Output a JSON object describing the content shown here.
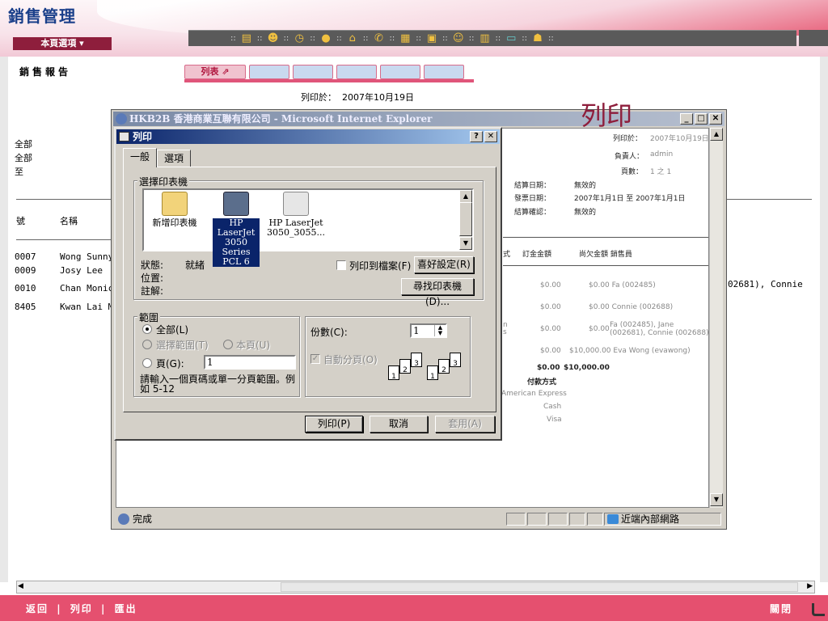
{
  "app": {
    "brand": "銷售管理",
    "menu_label": "本頁選項 ▾"
  },
  "toolbar": {
    "icons": [
      "docs-icon",
      "group-icon",
      "clock-icon",
      "coin-icon",
      "house-icon",
      "phone-icon",
      "calculator-icon",
      "clipboard-icon",
      "people-icon",
      "notepad-icon",
      "screen-icon",
      "users-icon"
    ]
  },
  "page": {
    "title": "銷售報告",
    "tabs": [
      "列表 ⇗",
      "",
      "",
      "",
      "",
      ""
    ],
    "printed_on_label": "列印於：",
    "printed_on_value": "2007年10月19日",
    "left_labels": [
      "全部",
      "全部",
      "至"
    ],
    "columns": {
      "no": "號",
      "name": "名稱"
    },
    "rows": [
      {
        "no": "0007",
        "name": "Wong Sunny"
      },
      {
        "no": "0009",
        "name": "Josy Lee"
      },
      {
        "no": "0010",
        "name": "Chan Monica"
      },
      {
        "no": "8405",
        "name": "Kwan Lai Ma"
      }
    ],
    "right_overflow": "02681), Connie",
    "annotation": "列印"
  },
  "ie_window": {
    "title": "HKB2B 香港商業互聯有限公司 - Microsoft Internet Explorer",
    "status_text": "完成",
    "zone": "近端內部網路",
    "report": {
      "printed_on_label": "列印於：",
      "printed_on_value": "2007年10月19日",
      "owner_label": "負責人：",
      "owner_value": "admin",
      "pages_label": "頁數：",
      "pages_value": "1 之 1",
      "settle_date_label": "結算日期：",
      "settle_date_value": "無效的",
      "invoice_date_label": "發票日期：",
      "invoice_date_value": "2007年1月1日 至 2007年1月1日",
      "settle_status_label": "結算確認：",
      "settle_status_value": "無效的",
      "col_method": "式",
      "col_total": "訂金金額",
      "col_outstanding": "尚欠金額 銷售員",
      "lines": [
        {
          "total": "$0.00",
          "outstanding": "$0.00 Fa (002485)"
        },
        {
          "total": "$0.00",
          "outstanding": "$0.00 Connie (002688)"
        },
        {
          "total": "$0.00",
          "outstanding": "$0.00",
          "staff": "Fa (002485), Jane (002681), Connie (002688)"
        },
        {
          "total": "$0.00",
          "outstanding": "$10,000.00 Eva Wong (evawong)"
        }
      ],
      "sum_total": "$0.00",
      "sum_outstanding": "$10,000.00",
      "pay_label": "付款方式",
      "pay_methods": [
        "American Express",
        "Cash",
        "Visa"
      ],
      "frag1": "n",
      "frag2": "s"
    }
  },
  "print_dialog": {
    "title": "列印",
    "help": "?",
    "close": "✕",
    "tabs": [
      "一般",
      "選項"
    ],
    "select_printer": "選擇印表機",
    "printers": [
      {
        "name": "新增印表機",
        "selected": false
      },
      {
        "name": "HP LaserJet 3050 Series PCL 6",
        "selected": true
      },
      {
        "name": "HP LaserJet 3050_3055...",
        "selected": false
      }
    ],
    "status_label": "狀態:",
    "status_value": "就緒",
    "location_label": "位置:",
    "comment_label": "註解:",
    "print_to_file": "列印到檔案(F)",
    "preferences": "喜好設定(R)",
    "find_printer": "尋找印表機(D)...",
    "range_label": "範圍",
    "range_all": "全部(L)",
    "range_selection": "選擇範圍(T)",
    "range_current": "本頁(U)",
    "range_pages": "頁(G):",
    "pages_value": "1",
    "range_hint": "請輸入一個頁碼或單一分頁範圍。例如 5-12",
    "copies_label": "份數(C):",
    "copies_value": "1",
    "collate": "自動分頁(O)",
    "print_btn": "列印(P)",
    "cancel_btn": "取消",
    "apply_btn": "套用(A)"
  },
  "footer": {
    "back": "返回",
    "print": "列印",
    "export": "匯出",
    "sep": "|",
    "close": "關閉"
  }
}
